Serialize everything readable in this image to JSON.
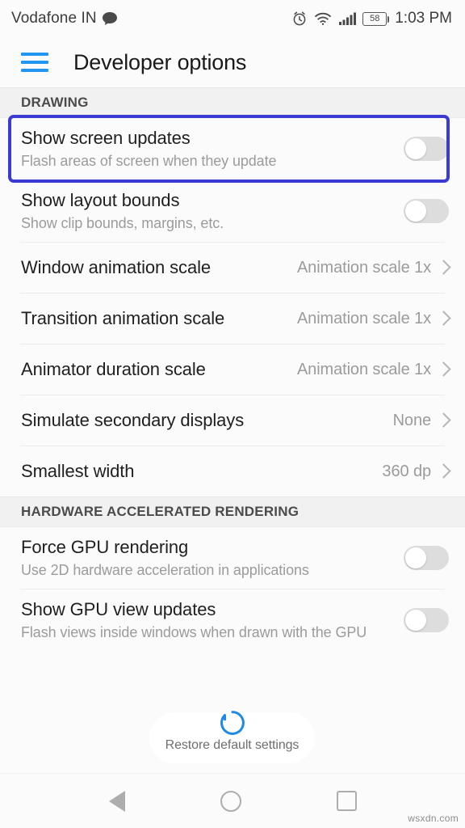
{
  "status_bar": {
    "carrier": "Vodafone IN",
    "message_icon": "message-bubble-icon",
    "alarm_icon": "alarm-clock-icon",
    "wifi_icon": "wifi-icon",
    "signal_icon": "cellular-signal-icon",
    "battery_level": "58",
    "time": "1:03 PM"
  },
  "app_bar": {
    "menu_icon": "hamburger-menu-icon",
    "title": "Developer options",
    "menu_color": "#2196f3"
  },
  "sections": [
    {
      "header": "DRAWING",
      "rows": [
        {
          "title": "Show screen updates",
          "subtitle": "Flash areas of screen when they update",
          "control": "toggle",
          "toggle_on": false,
          "highlighted": true
        },
        {
          "title": "Show layout bounds",
          "subtitle": "Show clip bounds, margins, etc.",
          "control": "toggle",
          "toggle_on": false,
          "highlighted": false
        },
        {
          "title": "Window animation scale",
          "subtitle": "",
          "control": "value",
          "value": "Animation scale 1x",
          "highlighted": false
        },
        {
          "title": "Transition animation scale",
          "subtitle": "",
          "control": "value",
          "value": "Animation scale 1x",
          "highlighted": false
        },
        {
          "title": "Animator duration scale",
          "subtitle": "",
          "control": "value",
          "value": "Animation scale 1x",
          "highlighted": false
        },
        {
          "title": "Simulate secondary displays",
          "subtitle": "",
          "control": "value",
          "value": "None",
          "highlighted": false
        },
        {
          "title": "Smallest width",
          "subtitle": "",
          "control": "value",
          "value": "360 dp",
          "highlighted": false
        }
      ]
    },
    {
      "header": "HARDWARE ACCELERATED RENDERING",
      "rows": [
        {
          "title": "Force GPU rendering",
          "subtitle": "Use 2D hardware acceleration in applications",
          "control": "toggle",
          "toggle_on": false,
          "highlighted": false
        },
        {
          "title": "Show GPU view updates",
          "subtitle": "Flash views inside windows when drawn with the GPU",
          "control": "toggle",
          "toggle_on": false,
          "highlighted": false
        }
      ]
    }
  ],
  "toast": {
    "label": "Restore default settings",
    "spinner_icon": "circular-progress-spinner-icon",
    "spinner_color": "#1e88e5"
  },
  "nav_bar": {
    "back_icon": "back-triangle-icon",
    "home_icon": "home-circle-icon",
    "recents_icon": "recents-square-icon"
  },
  "watermark": "wsxdn.com",
  "colors": {
    "accent_blue": "#2196f3",
    "highlight_border": "#3b3bd2",
    "toggle_track_off": "#dddddd",
    "section_bg": "#f1f1f1"
  }
}
